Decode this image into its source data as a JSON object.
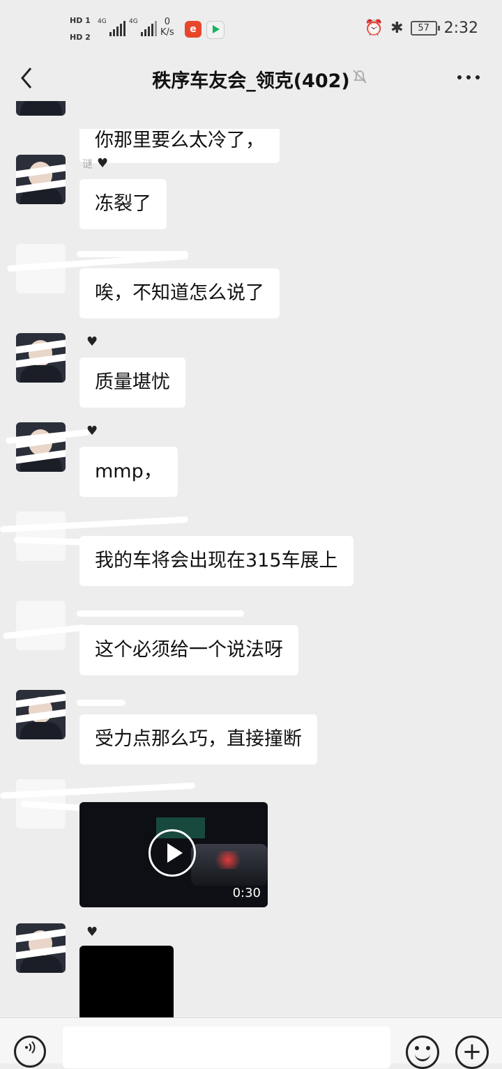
{
  "status_bar": {
    "hd1": "HD 1",
    "hd2": "HD 2",
    "net1": "4G",
    "net2": "4G",
    "speed_value": "0",
    "speed_unit": "K/s",
    "battery": "57",
    "time": "2:32"
  },
  "header": {
    "title": "秩序车友会_领克(402)"
  },
  "messages": [
    {
      "sender": "",
      "text": "你那里要么太冷了，"
    },
    {
      "sender": "谜",
      "text": "冻裂了"
    },
    {
      "sender": "",
      "text": "唉，不知道怎么说了"
    },
    {
      "sender": "",
      "text": "质量堪忧"
    },
    {
      "sender": "",
      "text": "mmp，"
    },
    {
      "sender": "",
      "text": "我的车将会出现在315车展上"
    },
    {
      "sender": "",
      "text": "这个必须给一个说法呀"
    },
    {
      "sender": "",
      "text": "受力点那么巧，直接撞断"
    }
  ],
  "video": {
    "duration": "0:30"
  },
  "icons": {
    "back": "chevron-left-icon",
    "mute": "bell-off-icon",
    "more": "more-dots-icon",
    "voice": "voice-icon",
    "emoji": "emoji-icon",
    "plus": "plus-icon"
  }
}
